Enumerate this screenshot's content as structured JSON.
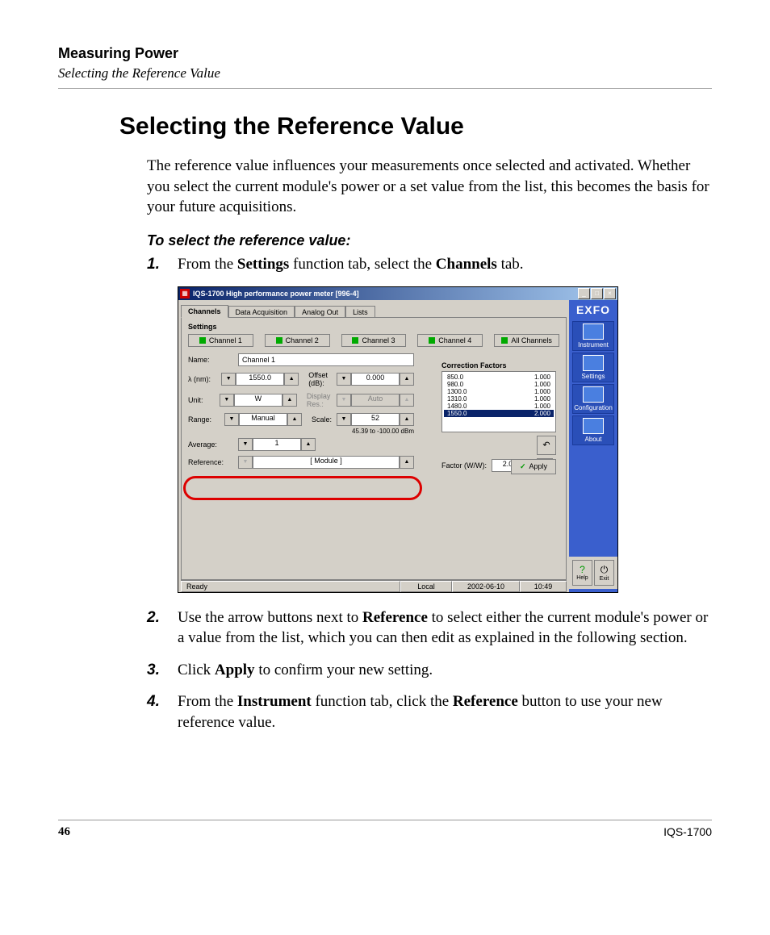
{
  "header": {
    "chapter": "Measuring Power",
    "subsection": "Selecting the Reference Value"
  },
  "title": "Selecting the Reference Value",
  "intro": "The reference value influences your measurements once selected and activated. Whether you select the current module's power or a set value from the list, this becomes the basis for your future acquisitions.",
  "subhead": "To select the reference value:",
  "steps": {
    "s1": {
      "num": "1.",
      "pre": "From the ",
      "b1": "Settings",
      "mid": " function tab, select the ",
      "b2": "Channels",
      "post": " tab."
    },
    "s2": {
      "num": "2.",
      "pre": "Use the arrow buttons next to ",
      "b1": "Reference",
      "post": " to select either the current module's power or a value from the list, which you can then edit as explained in the following section."
    },
    "s3": {
      "num": "3.",
      "pre": "Click ",
      "b1": "Apply",
      "post": " to confirm your new setting."
    },
    "s4": {
      "num": "4.",
      "pre": "From the ",
      "b1": "Instrument",
      "mid": " function tab, click the ",
      "b2": "Reference",
      "post": " button to use your new reference value."
    }
  },
  "screenshot": {
    "window_title": "IQS-1700 High performance power meter [996-4]",
    "tabs": {
      "t1": "Channels",
      "t2": "Data Acquisition",
      "t3": "Analog Out",
      "t4": "Lists"
    },
    "group_label": "Settings",
    "channels": {
      "c1": "Channel 1",
      "c2": "Channel 2",
      "c3": "Channel 3",
      "c4": "Channel 4",
      "all": "All Channels"
    },
    "fields": {
      "name_lbl": "Name:",
      "name_val": "Channel 1",
      "lambda_lbl": "λ  (nm):",
      "lambda_val": "1550.0",
      "offset_lbl": "Offset (dB):",
      "offset_val": "0.000",
      "unit_lbl": "Unit:",
      "unit_val": "W",
      "dispres_lbl": "Display Res.:",
      "dispres_val": "Auto",
      "range_lbl": "Range:",
      "range_val": "Manual",
      "scale_lbl": "Scale:",
      "scale_val": "52",
      "scale_note": "45.39 to -100.00 dBm",
      "avg_lbl": "Average:",
      "avg_val": "1",
      "ref_lbl": "Reference:",
      "ref_val": "[ Module ]"
    },
    "correction": {
      "title": "Correction Factors",
      "rows": [
        {
          "wl": "850.0",
          "f": "1.000"
        },
        {
          "wl": "980.0",
          "f": "1.000"
        },
        {
          "wl": "1300.0",
          "f": "1.000"
        },
        {
          "wl": "1310.0",
          "f": "1.000"
        },
        {
          "wl": "1480.0",
          "f": "1.000"
        },
        {
          "wl": "1550.0",
          "f": "2.000"
        }
      ],
      "factor_lbl": "Factor (W/W):",
      "factor_val": "2.000"
    },
    "apply_btn": "Apply",
    "sidebar": {
      "logo": "EXFO",
      "items": {
        "i1": "Instrument",
        "i2": "Settings",
        "i3": "Configuration",
        "i4": "About"
      },
      "help": "Help",
      "exit": "Exit"
    },
    "status": {
      "ready": "Ready",
      "local": "Local",
      "date": "2002-06-10",
      "time": "10:49"
    }
  },
  "footer": {
    "page": "46",
    "model": "IQS-1700"
  }
}
